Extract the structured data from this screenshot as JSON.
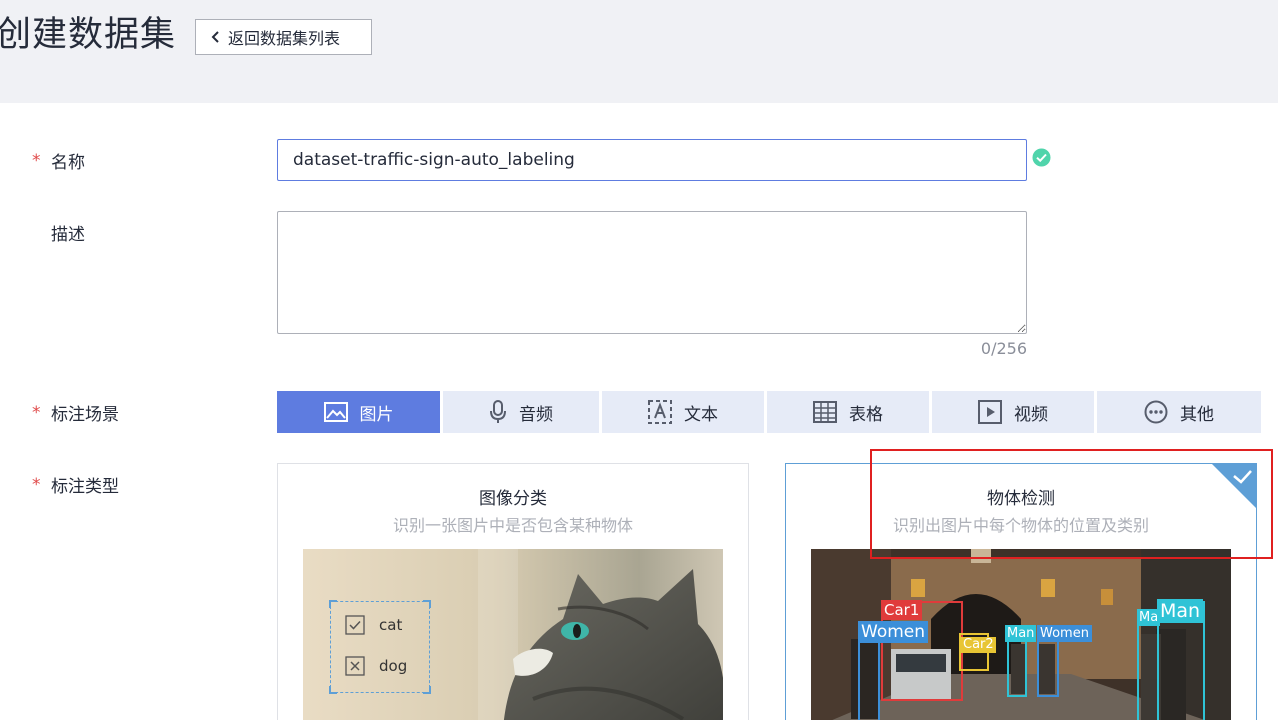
{
  "header": {
    "title": "创建数据集",
    "back_label": "返回数据集列表"
  },
  "form": {
    "name": {
      "label": "名称",
      "required": "*",
      "value": "dataset-traffic-sign-auto_labeling"
    },
    "description": {
      "label": "描述",
      "value": "",
      "count": "0/256"
    },
    "scene": {
      "label": "标注场景",
      "required": "*",
      "tabs": [
        {
          "label": "图片",
          "icon": "image-icon",
          "active": true
        },
        {
          "label": "音频",
          "icon": "microphone-icon",
          "active": false
        },
        {
          "label": "文本",
          "icon": "text-icon",
          "active": false
        },
        {
          "label": "表格",
          "icon": "table-icon",
          "active": false
        },
        {
          "label": "视频",
          "icon": "video-icon",
          "active": false
        },
        {
          "label": "其他",
          "icon": "more-icon",
          "active": false
        }
      ]
    },
    "type": {
      "label": "标注类型",
      "required": "*",
      "cards": [
        {
          "title": "图像分类",
          "desc": "识别一张图片中是否包含某种物体",
          "selected": false,
          "options": [
            "cat",
            "dog"
          ]
        },
        {
          "title": "物体检测",
          "desc": "识别出图片中每个物体的位置及类别",
          "selected": true,
          "labels": [
            "Car1",
            "Women",
            "Man",
            "Women",
            "Ma",
            "Man",
            "Car2"
          ]
        }
      ]
    }
  },
  "colors": {
    "accent": "#5e7ce0",
    "success": "#50d4ab",
    "required": "#e04a4a",
    "highlight": "#e02020"
  }
}
